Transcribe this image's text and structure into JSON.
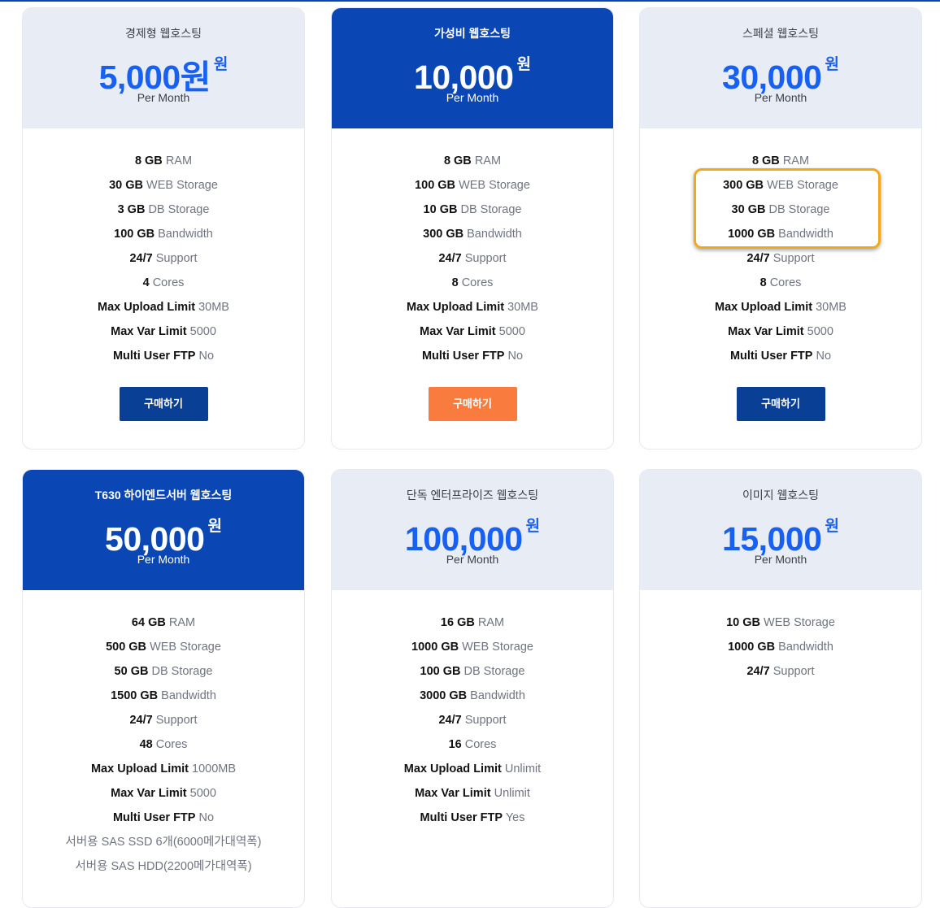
{
  "colors": {
    "primary_blue": "#0a47b5",
    "price_blue": "#1760f1",
    "header_gray": "#e8ecf4",
    "button_navy": "#0a3f96",
    "button_orange": "#f97b3d",
    "highlight_orange": "#f2a81c"
  },
  "plans": [
    {
      "name": "경제형 웹호스팅",
      "price": "5,000원",
      "unit": "원",
      "period": "Per Month",
      "features": [
        {
          "strong": "8 GB",
          "light": "RAM"
        },
        {
          "strong": "30 GB",
          "light": "WEB Storage"
        },
        {
          "strong": "3 GB",
          "light": "DB Storage"
        },
        {
          "strong": "100 GB",
          "light": "Bandwidth"
        },
        {
          "strong": "24/7",
          "light": "Support"
        },
        {
          "strong": "4",
          "light": "Cores"
        },
        {
          "strong": "Max Upload Limit",
          "light": "30MB"
        },
        {
          "strong": "Max Var Limit",
          "light": "5000"
        },
        {
          "strong": "Multi User FTP",
          "light": "No"
        }
      ],
      "button_label": "구매하기"
    },
    {
      "name": "가성비 웹호스팅",
      "price": "10,000",
      "unit": "원",
      "period": "Per Month",
      "features": [
        {
          "strong": "8 GB",
          "light": "RAM"
        },
        {
          "strong": "100 GB",
          "light": "WEB Storage"
        },
        {
          "strong": "10 GB",
          "light": "DB Storage"
        },
        {
          "strong": "300 GB",
          "light": "Bandwidth"
        },
        {
          "strong": "24/7",
          "light": "Support"
        },
        {
          "strong": "8",
          "light": "Cores"
        },
        {
          "strong": "Max Upload Limit",
          "light": "30MB"
        },
        {
          "strong": "Max Var Limit",
          "light": "5000"
        },
        {
          "strong": "Multi User FTP",
          "light": "No"
        }
      ],
      "button_label": "구매하기"
    },
    {
      "name": "스페셜 웹호스팅",
      "price": "30,000",
      "unit": "원",
      "period": "Per Month",
      "features": [
        {
          "strong": "8 GB",
          "light": "RAM"
        },
        {
          "strong": "300 GB",
          "light": "WEB Storage"
        },
        {
          "strong": "30 GB",
          "light": "DB Storage"
        },
        {
          "strong": "1000 GB",
          "light": "Bandwidth"
        },
        {
          "strong": "24/7",
          "light": "Support"
        },
        {
          "strong": "8",
          "light": "Cores"
        },
        {
          "strong": "Max Upload Limit",
          "light": "30MB"
        },
        {
          "strong": "Max Var Limit",
          "light": "5000"
        },
        {
          "strong": "Multi User FTP",
          "light": "No"
        }
      ],
      "button_label": "구매하기"
    },
    {
      "name": "T630 하이엔드서버 웹호스팅",
      "price": "50,000",
      "unit": "원",
      "period": "Per Month",
      "features": [
        {
          "strong": "64 GB",
          "light": "RAM"
        },
        {
          "strong": "500 GB",
          "light": "WEB Storage"
        },
        {
          "strong": "50 GB",
          "light": "DB Storage"
        },
        {
          "strong": "1500 GB",
          "light": "Bandwidth"
        },
        {
          "strong": "24/7",
          "light": "Support"
        },
        {
          "strong": "48",
          "light": "Cores"
        },
        {
          "strong": "Max Upload Limit",
          "light": "1000MB"
        },
        {
          "strong": "Max Var Limit",
          "light": "5000"
        },
        {
          "strong": "Multi User FTP",
          "light": "No"
        },
        {
          "strong": "",
          "light": "서버용 SAS SSD 6개(6000메가대역폭)"
        },
        {
          "strong": "",
          "light": "서버용 SAS HDD(2200메가대역폭)"
        }
      ]
    },
    {
      "name": "단독 엔터프라이즈 웹호스팅",
      "price": "100,000",
      "unit": "원",
      "period": "Per Month",
      "features": [
        {
          "strong": "16 GB",
          "light": "RAM"
        },
        {
          "strong": "1000 GB",
          "light": "WEB Storage"
        },
        {
          "strong": "100 GB",
          "light": "DB Storage"
        },
        {
          "strong": "3000 GB",
          "light": "Bandwidth"
        },
        {
          "strong": "24/7",
          "light": "Support"
        },
        {
          "strong": "16",
          "light": "Cores"
        },
        {
          "strong": "Max Upload Limit",
          "light": "Unlimit"
        },
        {
          "strong": "Max Var Limit",
          "light": "Unlimit"
        },
        {
          "strong": "Multi User FTP",
          "light": "Yes"
        }
      ]
    },
    {
      "name": "이미지 웹호스팅",
      "price": "15,000",
      "unit": "원",
      "period": "Per Month",
      "features": [
        {
          "strong": "10 GB",
          "light": "WEB Storage"
        },
        {
          "strong": "1000 GB",
          "light": "Bandwidth"
        },
        {
          "strong": "24/7",
          "light": "Support"
        }
      ]
    }
  ]
}
